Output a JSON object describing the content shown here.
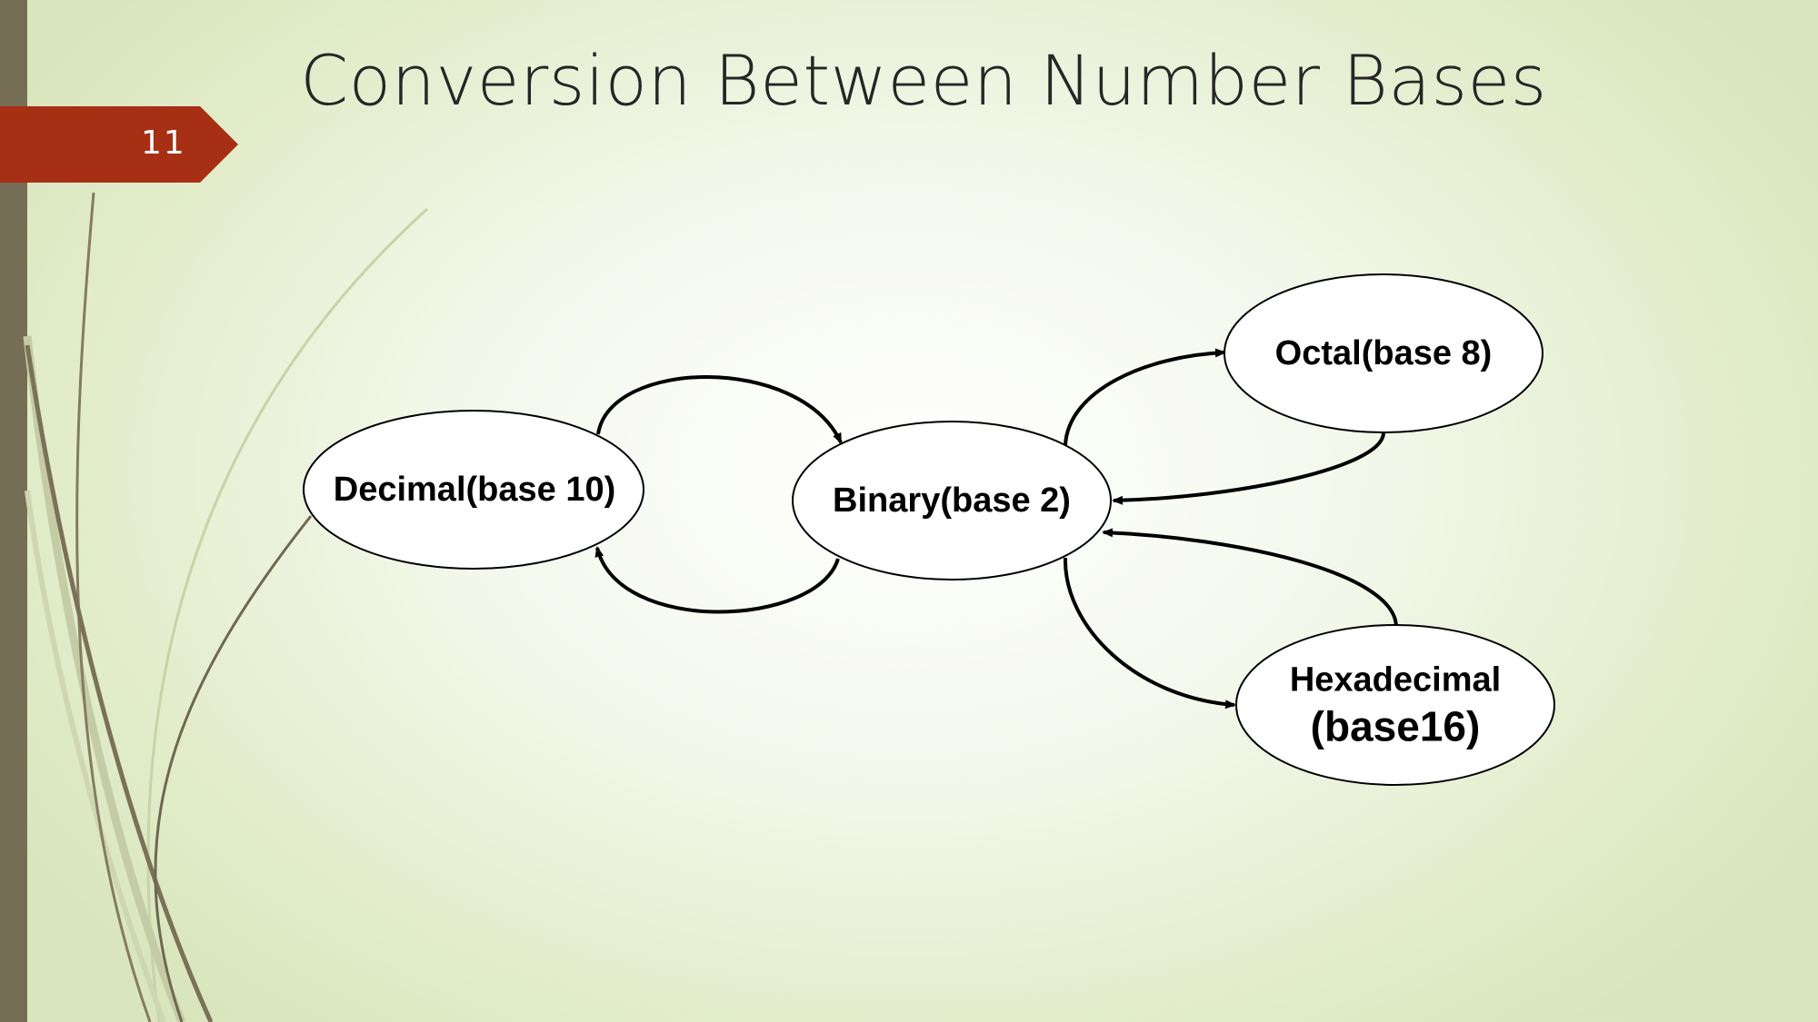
{
  "slide": {
    "number": "11",
    "title": "Conversion Between Number Bases"
  },
  "diagram": {
    "nodes": {
      "decimal": {
        "label": "Decimal(base 10)"
      },
      "binary": {
        "label": "Binary(base 2)"
      },
      "octal": {
        "label": "Octal(base 8)"
      },
      "hexadecimal": {
        "line1": "Hexadecimal",
        "line2": "(base16)"
      }
    },
    "edges": [
      {
        "from": "decimal",
        "to": "binary"
      },
      {
        "from": "binary",
        "to": "decimal"
      },
      {
        "from": "binary",
        "to": "octal"
      },
      {
        "from": "octal",
        "to": "binary"
      },
      {
        "from": "binary",
        "to": "hexadecimal"
      },
      {
        "from": "hexadecimal",
        "to": "binary"
      }
    ]
  },
  "colors": {
    "accent_tab": "#a72f14",
    "left_bar": "#766e54",
    "node_fill": "#ffffff",
    "stroke": "#000000"
  }
}
